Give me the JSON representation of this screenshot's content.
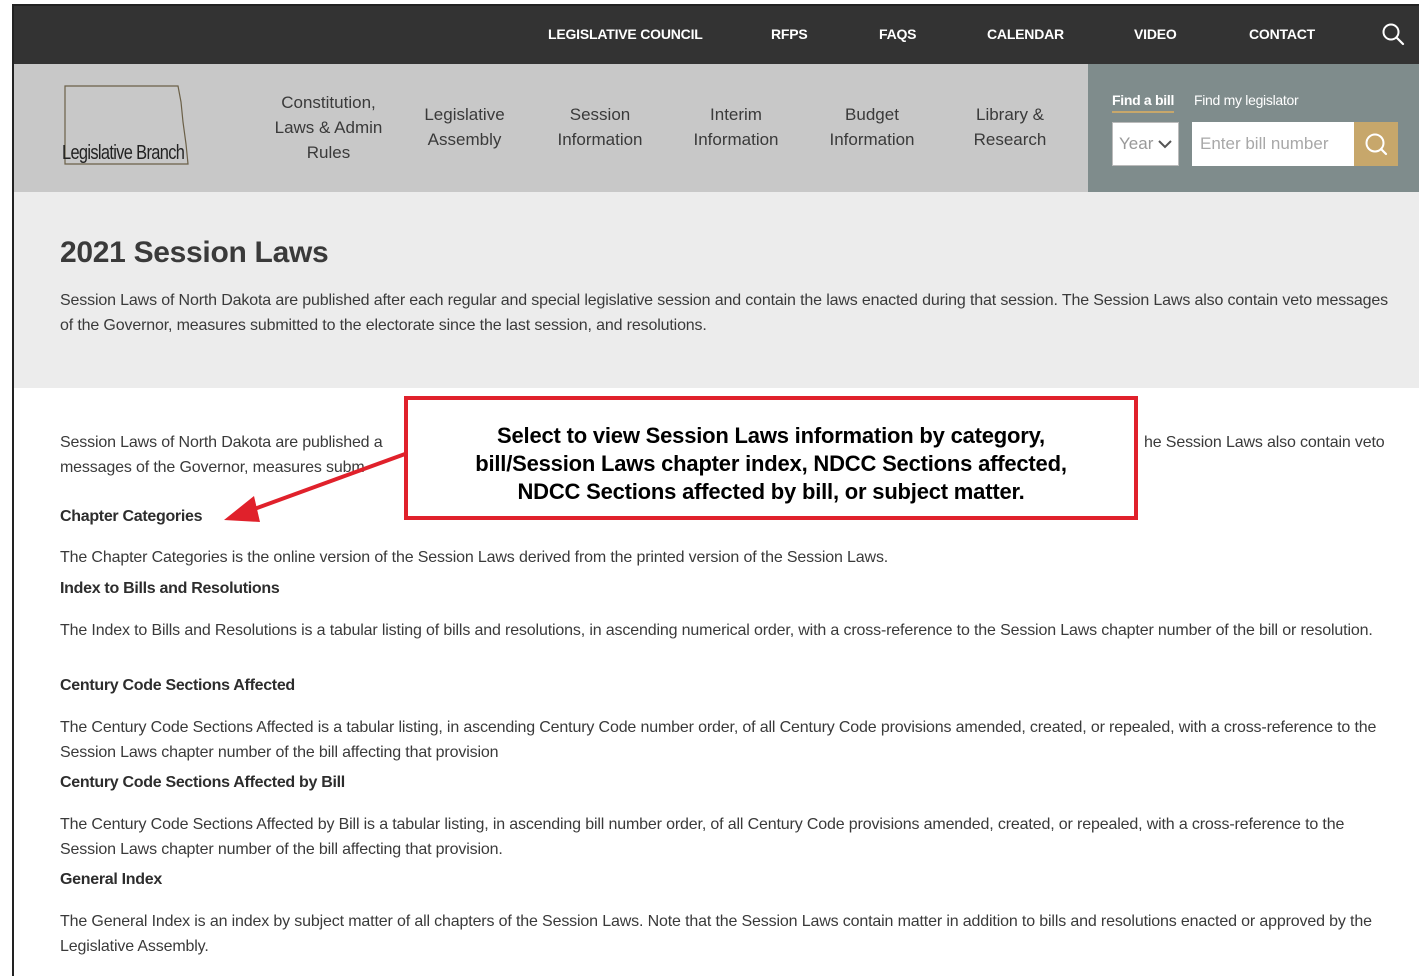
{
  "topnav": {
    "links": [
      "LEGISLATIVE COUNCIL",
      "RFPS",
      "FAQS",
      "CALENDAR",
      "VIDEO",
      "CONTACT"
    ]
  },
  "header": {
    "logo_text": "Legislative Branch",
    "nav": [
      "Constitution, Laws & Admin Rules",
      "Legislative Assembly",
      "Session Information",
      "Interim Information",
      "Budget Information",
      "Library & Research"
    ]
  },
  "find": {
    "tab_bill": "Find a bill",
    "tab_legislator": "Find my legislator",
    "year_value": "Year",
    "bill_placeholder": "Enter bill number"
  },
  "hero": {
    "title": "2021 Session Laws",
    "description": "Session Laws of North Dakota are published after each regular and special legislative session and contain the laws enacted during that session. The Session Laws also contain veto messages of the Governor, measures submitted to the electorate since the last session, and resolutions."
  },
  "content": {
    "intro_left": "Session Laws of North Dakota are published a",
    "intro_right": "he Session Laws also contain veto",
    "intro_line2": "messages of the Governor, measures subm",
    "sections": [
      {
        "link": "Chapter Categories",
        "text": "The Chapter Categories is the online version of the Session Laws derived from the printed version of the Session Laws."
      },
      {
        "link": "Index to Bills and Resolutions",
        "text": "The Index to Bills and Resolutions is a tabular listing of bills and resolutions, in ascending numerical order, with a cross-reference to the Session Laws chapter number of the bill or resolution."
      },
      {
        "link": "Century Code Sections Affected",
        "text": "The Century Code Sections Affected is a tabular listing, in ascending Century Code number order, of all Century Code provisions amended, created, or repealed, with a cross-reference to the Session Laws chapter number of the bill affecting that provision"
      },
      {
        "link": "Century Code Sections Affected by Bill",
        "text": "The Century Code Sections Affected by Bill is a tabular listing, in ascending bill number order, of all Century Code provisions amended, created, or repealed, with a cross-reference to the Session Laws chapter number of the bill affecting that provision."
      },
      {
        "link": "General Index",
        "text": "The General Index is an index by subject matter of all chapters of the Session Laws. Note that the Session Laws contain matter in addition to bills and resolutions enacted or approved by the Legislative Assembly."
      }
    ]
  },
  "callout": {
    "lines": [
      "Select to view Session Laws information by category,",
      "bill/Session Laws chapter index, NDCC Sections affected,",
      "NDCC Sections affected by bill, or subject matter."
    ]
  },
  "colors": {
    "topbar": "#333333",
    "header": "#c8c8c8",
    "findbox": "#7f8c8c",
    "accent_gold": "#c7a76b",
    "hero_bg": "#ececec",
    "callout_red": "#e0212b"
  },
  "icons": {
    "top_search": "search-icon",
    "bill_search": "search-icon",
    "year_dropdown": "chevron-down-icon"
  }
}
